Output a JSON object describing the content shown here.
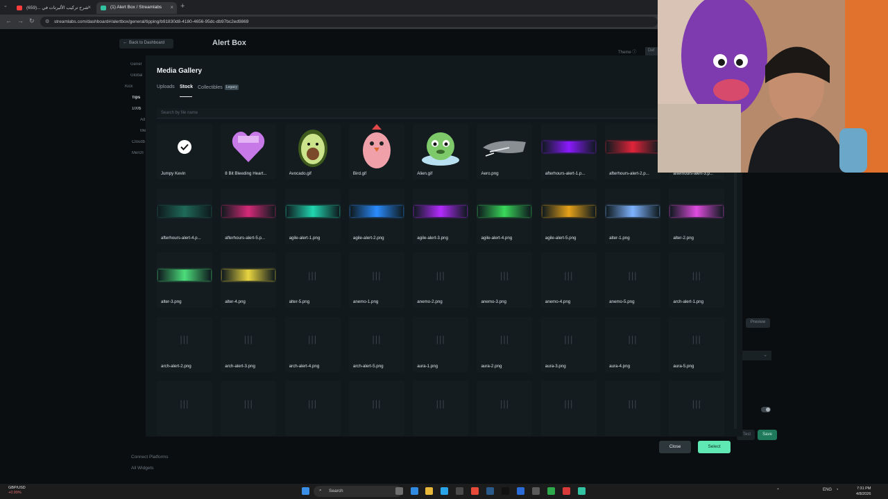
{
  "browser": {
    "tabs": [
      {
        "title": "شرح تركيب الأليرتات في ...(659)",
        "favicon_color": "#ff3d3d"
      },
      {
        "title": "(1) Alert Box / Streamlabs",
        "favicon_color": "#31c3a2"
      }
    ],
    "url": "streamlabs.com/dashboard#/alertbox/general/tipping/b91830d8-4180-4656-95dc-db97bc2ed9869"
  },
  "page": {
    "back_label": "Back to Dashboard",
    "title": "Alert Box",
    "theme_label": "Theme",
    "default_label": "Def",
    "sidenav": [
      "Gener",
      "Global",
      "Kick",
      "Tips",
      "100$",
      "Ad",
      "Me",
      "Cloudb",
      "Merch"
    ],
    "bottom_links": [
      "Connect Platforms",
      "All Widgets"
    ],
    "preview_label": "Preview",
    "test_label": "Test",
    "save_label": "Save"
  },
  "modal": {
    "title": "Media Gallery",
    "tabs": [
      {
        "label": "Uploads"
      },
      {
        "label": "Stock"
      },
      {
        "label": "Collectibles",
        "badge": "Legacy"
      }
    ],
    "search_placeholder": "Search by file name",
    "items": [
      {
        "name": "Jumpy Kevin",
        "thumb": "check-icon"
      },
      {
        "name": "8 Bit Bleeding Heart...",
        "thumb": "heart-icon"
      },
      {
        "name": "Avocado.gif",
        "thumb": "avocado-icon"
      },
      {
        "name": "Bird.gif",
        "thumb": "bird-icon"
      },
      {
        "name": "Alien.gif",
        "thumb": "alien-icon"
      },
      {
        "name": "Aero.png",
        "thumb": "aero-icon"
      },
      {
        "name": "afterhours-alert-1.p...",
        "thumb": "bar",
        "color": "#8a1aff"
      },
      {
        "name": "afterhours-alert-2.p...",
        "thumb": "bar",
        "color": "#e0243a"
      },
      {
        "name": "afterhours-alert-3.p...",
        "thumb": "bar",
        "color": "#2a7d6a"
      },
      {
        "name": "afterhours-alert-4.p...",
        "thumb": "bar",
        "color": "#1f6a58"
      },
      {
        "name": "afterhours-alert-5.p...",
        "thumb": "bar",
        "color": "#d42a78"
      },
      {
        "name": "agile-alert-1.png",
        "thumb": "bar",
        "color": "#21d6b0"
      },
      {
        "name": "agile-alert-2.png",
        "thumb": "bar",
        "color": "#2a8cff"
      },
      {
        "name": "agile-alert-3.png",
        "thumb": "bar",
        "color": "#b42bff"
      },
      {
        "name": "agile-alert-4.png",
        "thumb": "bar",
        "color": "#3ad85a"
      },
      {
        "name": "agile-alert-5.png",
        "thumb": "bar",
        "color": "#e6a21a"
      },
      {
        "name": "alter-1.png",
        "thumb": "bar",
        "color": "#7fb3ff"
      },
      {
        "name": "alter-2.png",
        "thumb": "bar",
        "color": "#e04ce0"
      },
      {
        "name": "alter-3.png",
        "thumb": "bar",
        "color": "#4cdc7a"
      },
      {
        "name": "alter-4.png",
        "thumb": "bar",
        "color": "#e8d440"
      },
      {
        "name": "alter-5.png",
        "thumb": "placeholder"
      },
      {
        "name": "anemo-1.png",
        "thumb": "placeholder"
      },
      {
        "name": "anemo-2.png",
        "thumb": "placeholder"
      },
      {
        "name": "anemo-3.png",
        "thumb": "placeholder"
      },
      {
        "name": "anemo-4.png",
        "thumb": "placeholder"
      },
      {
        "name": "anemo-5.png",
        "thumb": "placeholder"
      },
      {
        "name": "arch-alert-1.png",
        "thumb": "placeholder"
      },
      {
        "name": "arch-alert-2.png",
        "thumb": "placeholder"
      },
      {
        "name": "arch-alert-3.png",
        "thumb": "placeholder"
      },
      {
        "name": "arch-alert-4.png",
        "thumb": "placeholder"
      },
      {
        "name": "arch-alert-5.png",
        "thumb": "placeholder"
      },
      {
        "name": "aura-1.png",
        "thumb": "placeholder"
      },
      {
        "name": "aura-2.png",
        "thumb": "placeholder"
      },
      {
        "name": "aura-3.png",
        "thumb": "placeholder"
      },
      {
        "name": "aura-4.png",
        "thumb": "placeholder"
      },
      {
        "name": "aura-5.png",
        "thumb": "placeholder"
      },
      {
        "name": "",
        "thumb": "placeholder"
      },
      {
        "name": "",
        "thumb": "placeholder"
      },
      {
        "name": "",
        "thumb": "placeholder"
      },
      {
        "name": "",
        "thumb": "placeholder"
      },
      {
        "name": "",
        "thumb": "placeholder"
      },
      {
        "name": "",
        "thumb": "placeholder"
      },
      {
        "name": "",
        "thumb": "placeholder"
      },
      {
        "name": "",
        "thumb": "placeholder"
      },
      {
        "name": "",
        "thumb": "placeholder"
      }
    ],
    "close_label": "Close",
    "select_label": "Select",
    "accent_color": "#5fe8b3"
  },
  "taskbar": {
    "ticker_symbol": "GBP/USD",
    "ticker_change": "+0.99%",
    "search_label": "Search",
    "lang": "ENG",
    "time": "7:31 PM",
    "date": "4/8/2026"
  }
}
